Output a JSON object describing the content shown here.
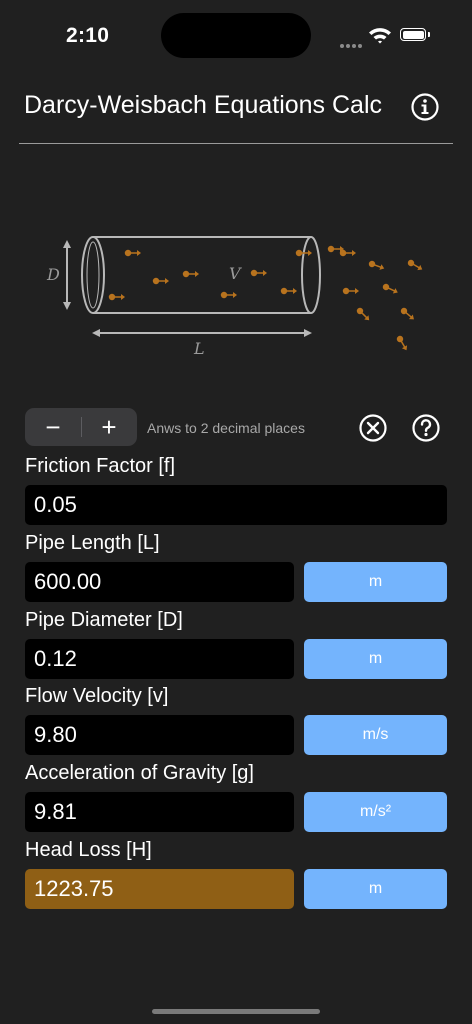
{
  "status": {
    "time": "2:10"
  },
  "header": {
    "title": "Darcy-Weisbach Equations Calc"
  },
  "diagram": {
    "diameter_label": "D",
    "velocity_label": "V",
    "length_label": "L"
  },
  "precision": {
    "minus": "−",
    "plus": "+",
    "text": "Anws to 2 decimal places"
  },
  "fields": {
    "friction": {
      "label": "Friction Factor [f]",
      "value": "0.05"
    },
    "length": {
      "label": "Pipe Length [L]",
      "value": "600.00",
      "unit": "m"
    },
    "diameter": {
      "label": "Pipe Diameter [D]",
      "value": "0.12",
      "unit": "m"
    },
    "velocity": {
      "label": "Flow Velocity [v]",
      "value": "9.80",
      "unit": "m/s"
    },
    "gravity": {
      "label": "Acceleration of Gravity [g]",
      "value": "9.81",
      "unit": "m/s²"
    },
    "headloss": {
      "label": "Head Loss [H]",
      "value": "1223.75",
      "unit": "m"
    }
  },
  "colors": {
    "background": "#202020",
    "input": "#000000",
    "result": "#8f5f15",
    "unit_button": "#74b4fd",
    "particle": "#b8731e"
  }
}
